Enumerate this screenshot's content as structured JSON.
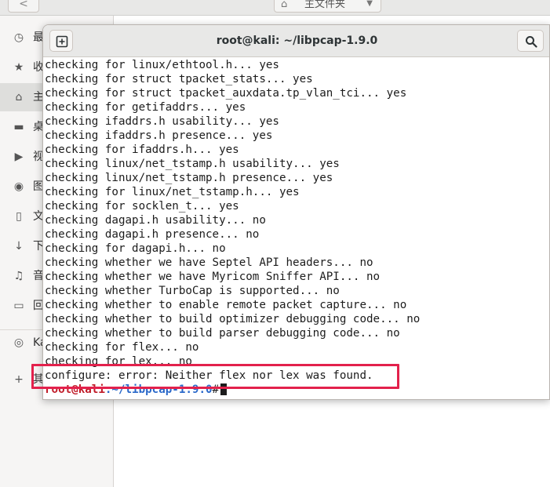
{
  "file_manager": {
    "back_label": "<",
    "location": "主文件夹",
    "sidebar": [
      {
        "icon": "clock-icon",
        "glyph": "◷",
        "label": "最"
      },
      {
        "icon": "star-icon",
        "glyph": "★",
        "label": "收"
      },
      {
        "icon": "home-icon",
        "glyph": "⌂",
        "label": "主",
        "active": true
      },
      {
        "icon": "folder-icon",
        "glyph": "▬",
        "label": "桌"
      },
      {
        "icon": "video-icon",
        "glyph": "▶",
        "label": "视"
      },
      {
        "icon": "camera-icon",
        "glyph": "◉",
        "label": "图"
      },
      {
        "icon": "document-icon",
        "glyph": "▯",
        "label": "文"
      },
      {
        "icon": "download-icon",
        "glyph": "↓",
        "label": "下"
      },
      {
        "icon": "music-icon",
        "glyph": "♫",
        "label": "音"
      },
      {
        "icon": "trash-icon",
        "glyph": "🗑",
        "label": "回"
      },
      {
        "icon": "disc-icon",
        "glyph": "◎",
        "label": "Ka"
      },
      {
        "icon": "plus-icon",
        "glyph": "+",
        "label": "其"
      }
    ]
  },
  "terminal": {
    "title": "root@kali: ~/libpcap-1.9.0",
    "lines": [
      "checking for linux/ethtool.h... yes",
      "checking for struct tpacket_stats... yes",
      "checking for struct tpacket_auxdata.tp_vlan_tci... yes",
      "checking for getifaddrs... yes",
      "checking ifaddrs.h usability... yes",
      "checking ifaddrs.h presence... yes",
      "checking for ifaddrs.h... yes",
      "checking linux/net_tstamp.h usability... yes",
      "checking linux/net_tstamp.h presence... yes",
      "checking for linux/net_tstamp.h... yes",
      "checking for socklen_t... yes",
      "checking dagapi.h usability... no",
      "checking dagapi.h presence... no",
      "checking for dagapi.h... no",
      "checking whether we have Septel API headers... no",
      "checking whether we have Myricom Sniffer API... no",
      "checking whether TurboCap is supported... no",
      "checking whether to enable remote packet capture... no",
      "checking whether to build optimizer debugging code... no",
      "checking whether to build parser debugging code... no",
      "checking for flex... no",
      "checking for lex... no",
      "configure: error: Neither flex nor lex was found."
    ],
    "prompt": {
      "user_host": "root@kali",
      "path": ":~/libpcap-1.9.0",
      "suffix": "#"
    }
  }
}
